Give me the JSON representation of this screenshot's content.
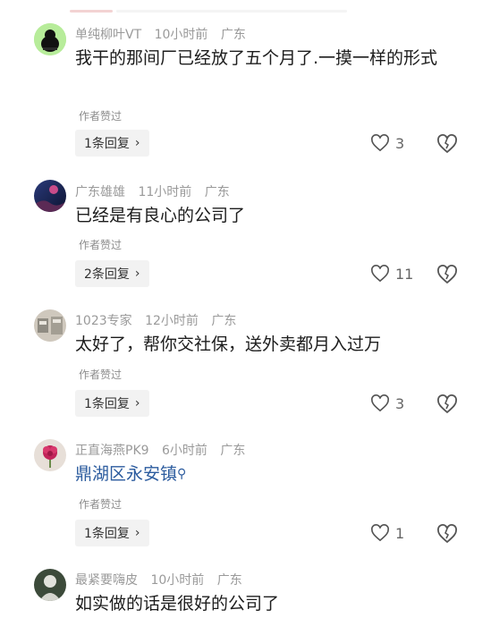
{
  "comments": [
    {
      "username": "单纯柳叶VT",
      "time": "10小时前",
      "location": "广东",
      "text": "我干的那间厂已经放了五个月了.一摸一样的形式",
      "author_liked": "作者赞过",
      "replies_label": "1条回复",
      "likes": "3",
      "avatar_icon": "black-blob-avatar-icon"
    },
    {
      "username": "广东雄雄",
      "time": "11小时前",
      "location": "广东",
      "text": "已经是有良心的公司了",
      "author_liked": "作者赞过",
      "replies_label": "2条回复",
      "likes": "11",
      "avatar_icon": "night-sky-avatar-icon"
    },
    {
      "username": "1023专家",
      "time": "12小时前",
      "location": "广东",
      "text": "太好了，帮你交社保，送外卖都月入过万",
      "author_liked": "作者赞过",
      "replies_label": "1条回复",
      "likes": "3",
      "avatar_icon": "photo-avatar-icon"
    },
    {
      "username": "正直海燕PK9",
      "time": "6小时前",
      "location": "广东",
      "text": "鼎湖区永安镇",
      "author_liked": "作者赞过",
      "replies_label": "1条回复",
      "likes": "1",
      "avatar_icon": "flower-avatar-icon"
    },
    {
      "username": "最紧要嗨皮",
      "time": "10小时前",
      "location": "广东",
      "text": "如实做的话是很好的公司了",
      "avatar_icon": "photo-avatar-icon"
    }
  ],
  "colors": {
    "link": "#2b5b9e",
    "meta": "#9a9a9a"
  }
}
